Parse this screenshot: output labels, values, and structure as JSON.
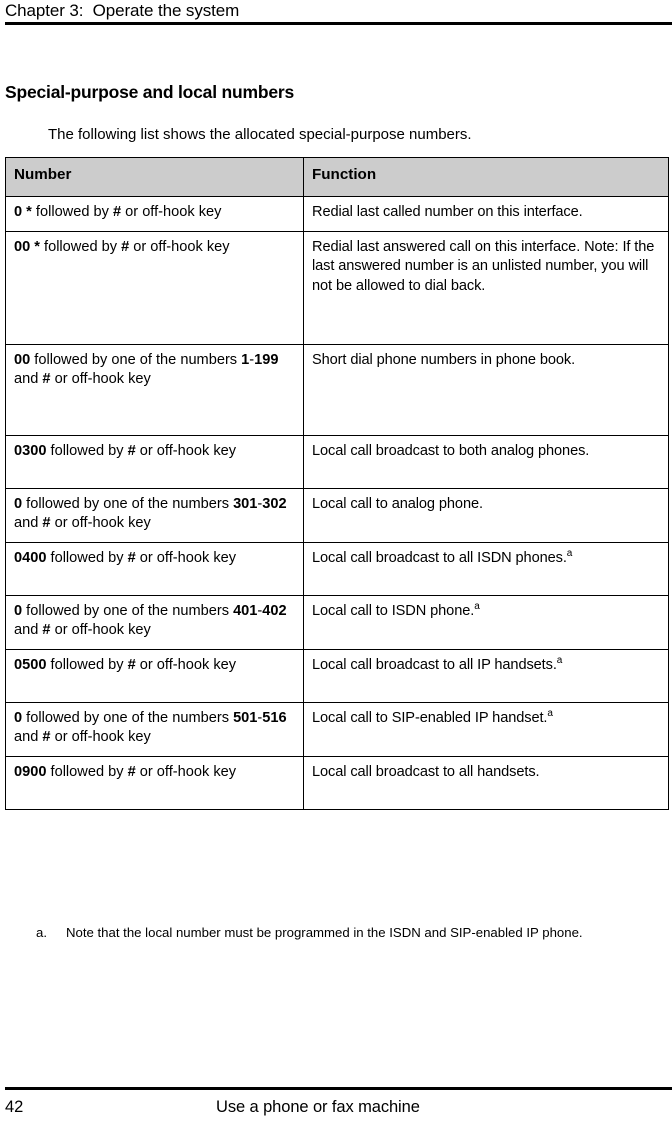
{
  "document": {
    "running_header": "Chapter 3:  Operate the system",
    "section_heading": "Special-purpose and local numbers",
    "intro_paragraph": "The following list shows the allocated special-purpose numbers.",
    "footer": {
      "page_number": "42",
      "footer_title": "Use a phone or fax machine"
    },
    "footnote": {
      "marker": "a.",
      "text": "Note that the local number must be programmed in the ISDN and SIP-enabled IP phone."
    }
  },
  "table": {
    "columns": [
      "Number",
      "Function"
    ],
    "rows": [
      {
        "number_html": "<b>0 *</b> followed by <b>#</b> or off-hook key",
        "number_text": "0 * followed by # or off-hook key",
        "function_html": "Redial last called number on this interface.",
        "function_text": "Redial last called number on this interface."
      },
      {
        "number_html": "<b>00 *</b> followed by <b>#</b> or off-hook key",
        "number_text": "00 * followed by # or off-hook key",
        "function_html": "Redial last answered call on this interface. Note: If the last answered number is an unlisted number, you will not be allowed to dial back.",
        "function_text": "Redial last answered call on this interface. Note: If the last answered number is an unlisted number, you will not be allowed to dial back."
      },
      {
        "number_html": "<b>00</b> followed by one of the numbers <b>1</b>-<b>199</b> and <b>#</b> or off-hook key",
        "number_text": "00 followed by one of the numbers 1-199 and # or off-hook key",
        "function_html": "Short dial phone numbers in phone book.",
        "function_text": "Short dial phone numbers in phone book."
      },
      {
        "number_html": "<b>0300</b> followed by <b>#</b> or off-hook key",
        "number_text": "0300 followed by # or off-hook key",
        "function_html": "Local call broadcast to both analog phones.",
        "function_text": "Local call broadcast to both analog phones."
      },
      {
        "number_html": "<b>0</b> followed by one of the numbers <b>301</b>-<b>302</b> and <b>#</b> or off-hook key",
        "number_text": "0 followed by one of the numbers 301-302 and # or off-hook key",
        "function_html": "Local call to analog phone.",
        "function_text": "Local call to analog phone."
      },
      {
        "number_html": "<b>0400</b> followed by <b>#</b> or off-hook key",
        "number_text": "0400 followed by # or off-hook key",
        "function_html": "Local call broadcast to all ISDN phones.<sup class=\"fn\">a</sup>",
        "function_text": "Local call broadcast to all ISDN phones.a"
      },
      {
        "number_html": "<b>0</b> followed by one of the numbers <b>401</b>-<b>402</b> and <b>#</b> or off-hook key",
        "number_text": "0 followed by one of the numbers 401-402 and # or off-hook key",
        "function_html": "Local call to ISDN phone.<sup class=\"fn\">a</sup>",
        "function_text": "Local call to ISDN phone.a"
      },
      {
        "number_html": "<b>0500</b> followed by <b>#</b> or off-hook key",
        "number_text": "0500 followed by # or off-hook key",
        "function_html": "Local call broadcast to all IP handsets.<sup class=\"fn\">a</sup>",
        "function_text": "Local call broadcast to all IP handsets.a"
      },
      {
        "number_html": "<b>0</b> followed by one of the numbers <b>501</b>-<b>516</b> and <b>#</b> or off-hook key",
        "number_text": "0 followed by one of the numbers 501-516 and # or off-hook key",
        "function_html": "Local call to SIP-enabled IP handset.<sup class=\"fn\">a</sup>",
        "function_text": "Local call to SIP-enabled IP handset.a"
      },
      {
        "number_html": "<b>0900</b> followed by <b>#</b> or off-hook key",
        "number_text": "0900 followed by # or off-hook key",
        "function_html": "Local call broadcast to all handsets.",
        "function_text": "Local call broadcast to all handsets."
      }
    ]
  },
  "colors": {
    "page_background": "#ffffff",
    "text": "#000000",
    "table_header_fill": "#cccccc",
    "table_border": "#000000"
  }
}
